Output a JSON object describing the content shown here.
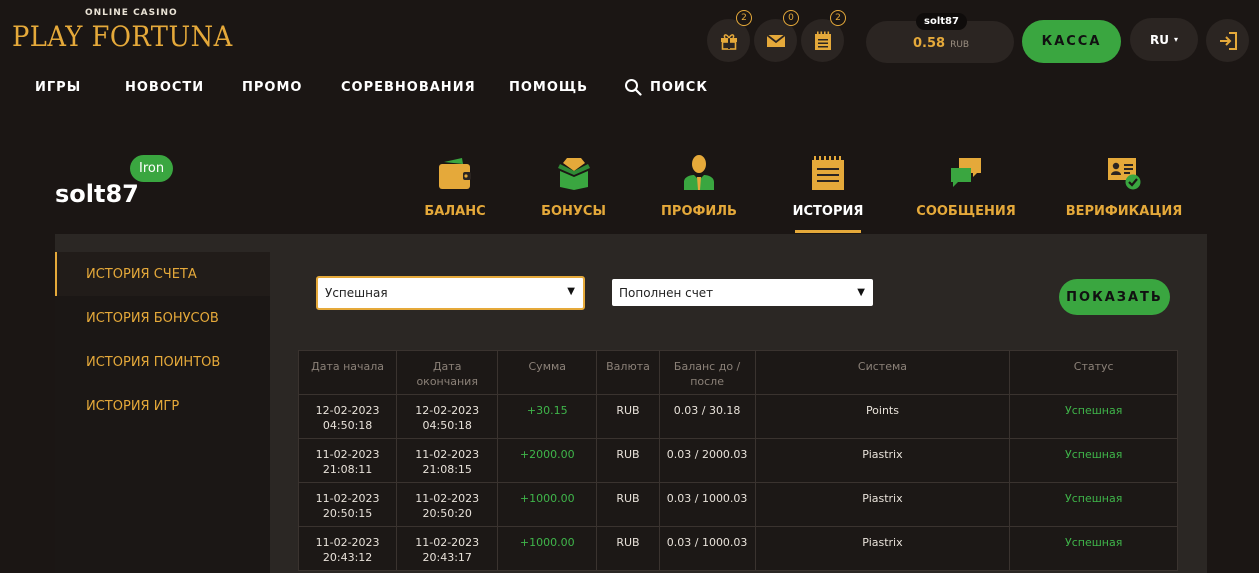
{
  "logo": {
    "tagline": "ONLINE CASINO",
    "brand": "PLAY FORTUNA"
  },
  "nav": {
    "games": "ИГРЫ",
    "news": "НОВОСТИ",
    "promo": "ПРОМО",
    "competitions": "СОРЕВНОВАНИЯ",
    "help": "ПОМОЩЬ",
    "search": "ПОИСК"
  },
  "header": {
    "gift_count": "2",
    "mail_count": "0",
    "tasks_count": "2",
    "username": "solt87",
    "balance": "0.58",
    "currency": "RUB",
    "cashier": "КАССА",
    "lang": "RU"
  },
  "colors": {
    "accent": "#e5a93a",
    "green": "#3aa640",
    "bg": "#1b1614"
  },
  "profile": {
    "username": "solt87",
    "level": "Iron",
    "tabs": [
      {
        "label": "БАЛАНС",
        "icon": "wallet-icon"
      },
      {
        "label": "БОНУСЫ",
        "icon": "gift-box-icon"
      },
      {
        "label": "ПРОФИЛЬ",
        "icon": "user-icon"
      },
      {
        "label": "ИСТОРИЯ",
        "icon": "history-icon"
      },
      {
        "label": "СООБЩЕНИЯ",
        "icon": "chat-icon"
      },
      {
        "label": "ВЕРИФИКАЦИЯ",
        "icon": "id-card-check-icon"
      }
    ]
  },
  "sidebar": {
    "items": [
      "ИСТОРИЯ СЧЕТА",
      "ИСТОРИЯ БОНУСОВ",
      "ИСТОРИЯ ПОИНТОВ",
      "ИСТОРИЯ ИГР"
    ]
  },
  "filters": {
    "status": "Успешная",
    "type": "Пополнен счет",
    "show": "ПОКАЗАТЬ"
  },
  "table": {
    "headers": {
      "start": [
        "Дата начала"
      ],
      "end": [
        "Дата",
        "окончания"
      ],
      "amount": [
        "Сумма"
      ],
      "currency": [
        "Валюта"
      ],
      "balance": [
        "Баланс до /",
        "после"
      ],
      "system": [
        "Система"
      ],
      "status": [
        "Статус"
      ]
    },
    "rows": [
      {
        "start_date": "12-02-2023",
        "start_time": "04:50:18",
        "end_date": "12-02-2023",
        "end_time": "04:50:18",
        "amount": "+30.15",
        "currency": "RUB",
        "balance": "0.03 / 30.18",
        "system": "Points",
        "status": "Успешная"
      },
      {
        "start_date": "11-02-2023",
        "start_time": "21:08:11",
        "end_date": "11-02-2023",
        "end_time": "21:08:15",
        "amount": "+2000.00",
        "currency": "RUB",
        "balance": "0.03 / 2000.03",
        "system": "Piastrix",
        "status": "Успешная"
      },
      {
        "start_date": "11-02-2023",
        "start_time": "20:50:15",
        "end_date": "11-02-2023",
        "end_time": "20:50:20",
        "amount": "+1000.00",
        "currency": "RUB",
        "balance": "0.03 / 1000.03",
        "system": "Piastrix",
        "status": "Успешная"
      },
      {
        "start_date": "11-02-2023",
        "start_time": "20:43:12",
        "end_date": "11-02-2023",
        "end_time": "20:43:17",
        "amount": "+1000.00",
        "currency": "RUB",
        "balance": "0.03 / 1000.03",
        "system": "Piastrix",
        "status": "Успешная"
      }
    ]
  }
}
